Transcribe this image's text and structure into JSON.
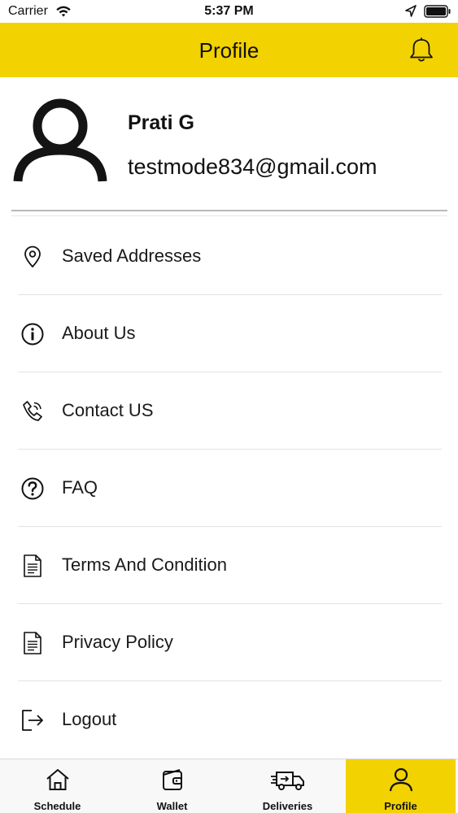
{
  "status_bar": {
    "carrier": "Carrier",
    "time": "5:37 PM",
    "wifi_icon": "wifi-icon",
    "location_icon": "location-arrow-icon",
    "battery_icon": "battery-icon"
  },
  "nav": {
    "title": "Profile",
    "notification_icon": "bell-icon",
    "background_color": "#f2d200"
  },
  "profile": {
    "avatar_icon": "user-avatar-icon",
    "name": "Prati G",
    "email": "testmode834@gmail.com"
  },
  "menu": {
    "items": [
      {
        "label": "Saved Addresses",
        "icon": "map-pin-icon"
      },
      {
        "label": "About Us",
        "icon": "info-circle-icon"
      },
      {
        "label": "Contact US",
        "icon": "phone-icon"
      },
      {
        "label": "FAQ",
        "icon": "question-circle-icon"
      },
      {
        "label": "Terms And Condition",
        "icon": "document-icon"
      },
      {
        "label": "Privacy Policy",
        "icon": "document-icon"
      },
      {
        "label": "Logout",
        "icon": "logout-icon"
      }
    ]
  },
  "tabs": {
    "items": [
      {
        "label": "Schedule",
        "icon": "home-icon",
        "active": false
      },
      {
        "label": "Wallet",
        "icon": "wallet-icon",
        "active": false
      },
      {
        "label": "Deliveries",
        "icon": "truck-icon",
        "active": false
      },
      {
        "label": "Profile",
        "icon": "user-icon",
        "active": true
      }
    ],
    "active_color": "#f2d200"
  }
}
